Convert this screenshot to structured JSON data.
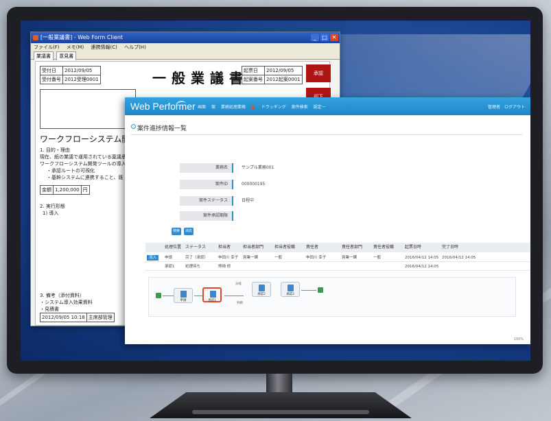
{
  "back_window": {
    "title": "[一般業議書] - Web Form Client",
    "menu": [
      "ファイル(F)",
      "メモ(M)",
      "連携情報(C)",
      "ヘルプ(H)"
    ],
    "tabs": [
      "業議書",
      "意見書"
    ],
    "doc_title": "一般業議書",
    "fields": {
      "date_label": "受付日",
      "date_value": "2012/09/05",
      "receipt_no_label": "受付番号",
      "receipt_no_value": "2012受理0001",
      "issue_date_label": "起票日",
      "issue_date_value": "2012/09/05",
      "approval_no_label": "起案番号",
      "approval_no_value": "2012起案0001"
    },
    "stamps": [
      "承認",
      "却下"
    ],
    "subject": "ワークフローシステム開発ツール",
    "amount_label": "金額",
    "amount_value": "1,200,000",
    "amount_unit": "円",
    "body_lines": [
      "1. 目的・理由",
      "現在、紙の業議で運用されている稟議承認",
      "ワークフローシステム開発ツールの導入",
      "・承認ルートの可視化",
      "・基幹システムに連携すること、既",
      "2. 実行形態",
      "1) 導入",
      "3. 備考（添付資料）",
      "・システム導入効果資料",
      "・見積書"
    ],
    "footer_date": "2012/09/05 10:18",
    "footer_dept": "主席部管理"
  },
  "front_window": {
    "brand": "Web Performer",
    "nav": [
      "画面",
      "案",
      "業務処理業務",
      "ドラッギング",
      "案件検索",
      "設定ー"
    ],
    "user": "管理者　ログアウト",
    "page_title": "案件進捗情報一覧",
    "form": [
      {
        "label": "業務名",
        "value": "サンプル業務001"
      },
      {
        "label": "案件ID",
        "value": "000000195"
      },
      {
        "label": "案件ステータス",
        "value": "日程中"
      },
      {
        "label": "案件承認期限",
        "value": ""
      }
    ],
    "buttons": {
      "search": "検索",
      "clear": "消去"
    },
    "table": {
      "headers": [
        "処理位置",
        "ステータス",
        "担当者",
        "担当者部門",
        "担当者役職",
        "責任者",
        "責任者部門",
        "責任者役職",
        "起票日時",
        "完了日時"
      ],
      "rows": [
        {
          "tag": "流入",
          "cells": [
            "申請",
            "完了（承認）",
            "申田川 幸子",
            "営業一課",
            "一般",
            "申田川 幸子",
            "営業一課",
            "一般",
            "2016/04/12 14:05",
            "2016/04/12 14:05"
          ]
        },
        {
          "tag": "",
          "cells": [
            "承認1",
            "処理待ち",
            "熊崎 修",
            "",
            "",
            "",
            "",
            "",
            "2016/04/12 14:05",
            ""
          ]
        }
      ]
    },
    "flow": {
      "nodes": [
        "申請",
        "承認1",
        "承認2",
        "承認3"
      ],
      "branch_labels": [
        "分岐",
        "判断"
      ]
    },
    "zoom": "100%"
  },
  "colors": {
    "header_blue": "#1f86c8",
    "accent_red": "#e3452a",
    "stamp_red": "#b01515",
    "label_bar_blue": "#2f8ad0"
  }
}
